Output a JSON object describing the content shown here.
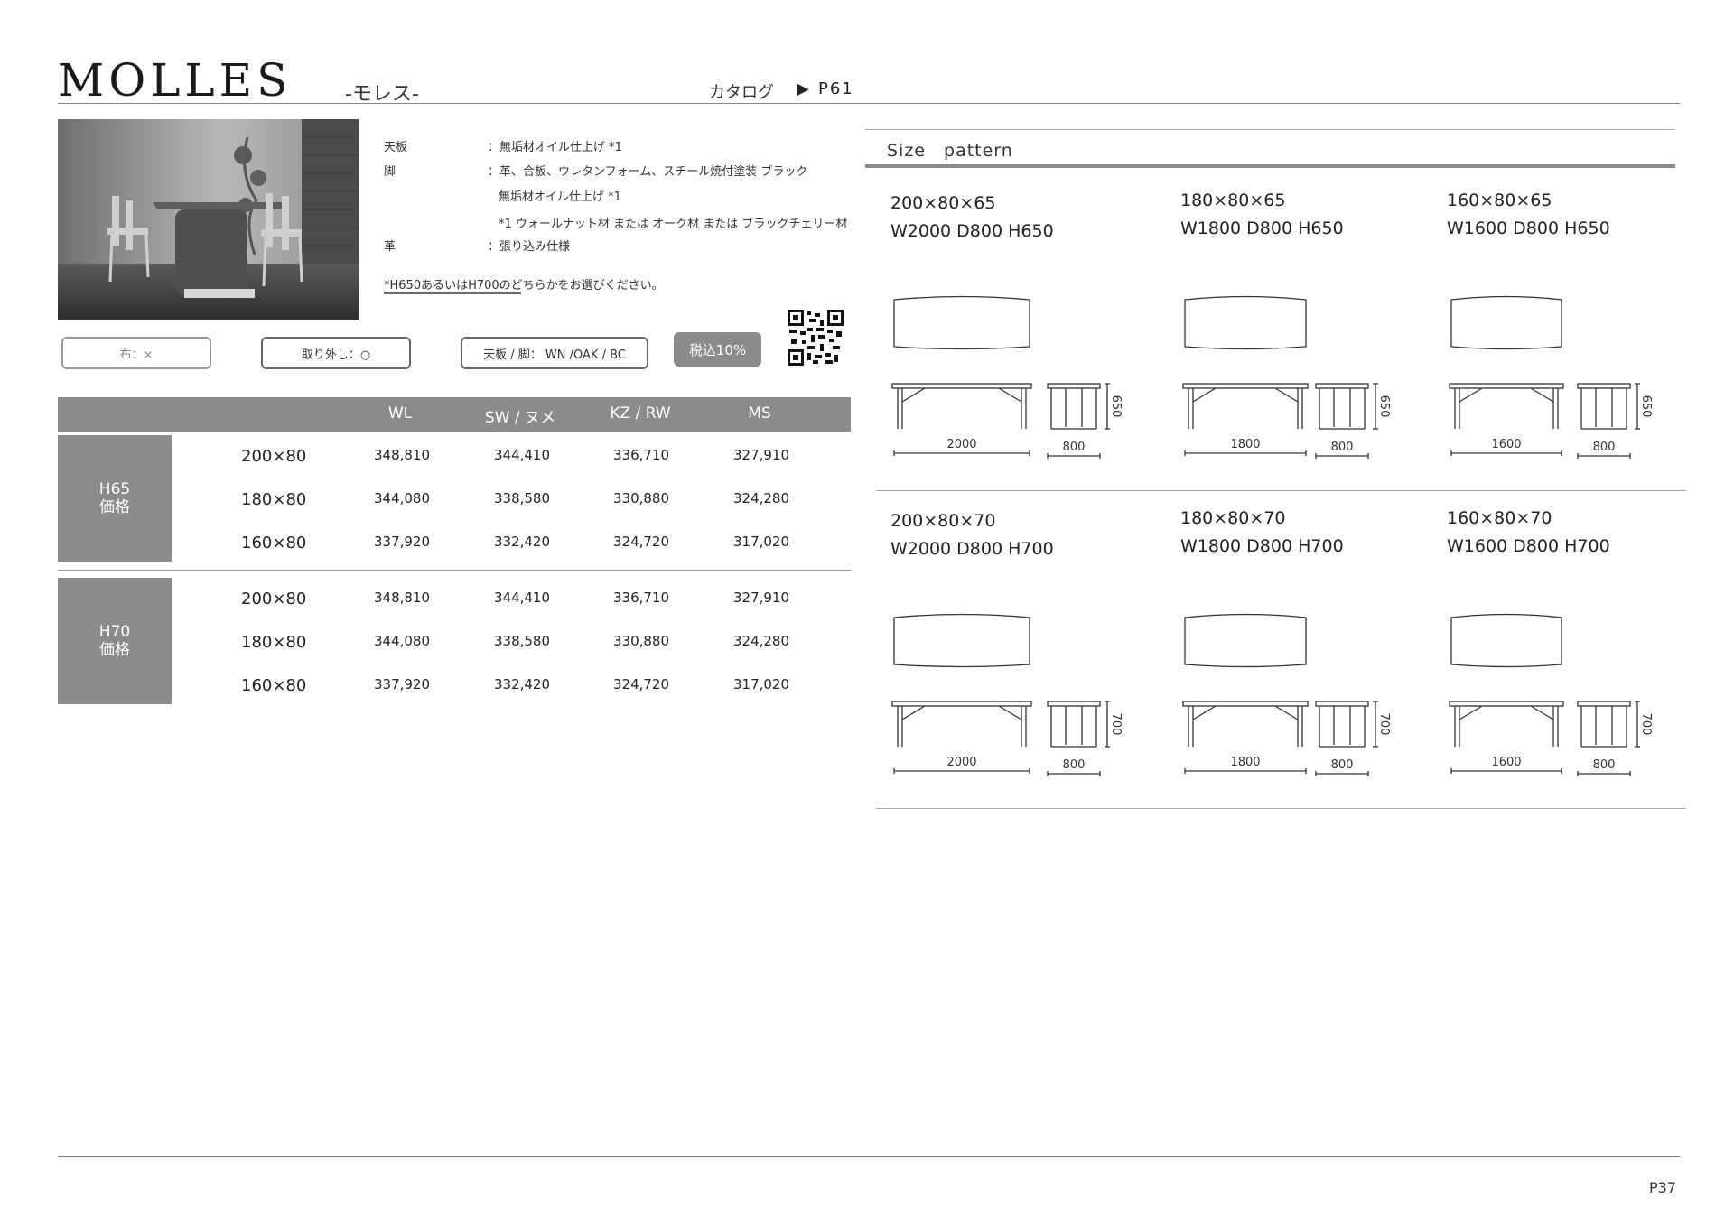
{
  "header": {
    "title": "MOLLES",
    "subtitle": "-モレス-",
    "catalog_label": "カタログ",
    "catalog_arrow": "▶",
    "catalog_page": "P61"
  },
  "specs": {
    "rows": [
      {
        "label": "天板",
        "value": "：無垢材オイル仕上げ *1"
      },
      {
        "label": "脚",
        "value": "：革、合板、ウレタンフォーム、スチール焼付塗装 ブラック"
      },
      {
        "label": "",
        "value": "無垢材オイル仕上げ *1"
      },
      {
        "label": "",
        "value": "*1 ウォールナット材 または オーク材 または ブラックチェリー材"
      },
      {
        "label": "革",
        "value": "：張り込み仕様"
      }
    ],
    "note": "*H650あるいはH700のどちらかをお選びください。"
  },
  "badges": {
    "fabric": "布：×",
    "removable": "取り外し：○",
    "materials": "天板 / 脚： WN /OAK / BC",
    "tax": "税込10%"
  },
  "price_table": {
    "columns": [
      "WL",
      "SW / ヌメ",
      "KZ / RW",
      "MS"
    ],
    "groups": [
      {
        "label_1": "H65",
        "label_2": "価格",
        "rows": [
          {
            "size": "200×80",
            "prices": [
              "348,810",
              "344,410",
              "336,710",
              "327,910"
            ]
          },
          {
            "size": "180×80",
            "prices": [
              "344,080",
              "338,580",
              "330,880",
              "324,280"
            ]
          },
          {
            "size": "160×80",
            "prices": [
              "337,920",
              "332,420",
              "324,720",
              "317,020"
            ]
          }
        ]
      },
      {
        "label_1": "H70",
        "label_2": "価格",
        "rows": [
          {
            "size": "200×80",
            "prices": [
              "348,810",
              "344,410",
              "336,710",
              "327,910"
            ]
          },
          {
            "size": "180×80",
            "prices": [
              "344,080",
              "338,580",
              "330,880",
              "324,280"
            ]
          },
          {
            "size": "160×80",
            "prices": [
              "337,920",
              "332,420",
              "324,720",
              "317,020"
            ]
          }
        ]
      }
    ]
  },
  "size_pattern": {
    "title": "Size　pattern",
    "items": [
      {
        "dim1": "200×80×65",
        "dim2": "W2000 D800 H650",
        "width": "2000",
        "depth": "800",
        "height": "650"
      },
      {
        "dim1": "180×80×65",
        "dim2": "W1800 D800 H650",
        "width": "1800",
        "depth": "800",
        "height": "650"
      },
      {
        "dim1": "160×80×65",
        "dim2": "W1600 D800 H650",
        "width": "1600",
        "depth": "800",
        "height": "650"
      },
      {
        "dim1": "200×80×70",
        "dim2": "W2000 D800 H700",
        "width": "2000",
        "depth": "800",
        "height": "700"
      },
      {
        "dim1": "180×80×70",
        "dim2": "W1800 D800 H700",
        "width": "1800",
        "depth": "800",
        "height": "700"
      },
      {
        "dim1": "160×80×70",
        "dim2": "W1600 D800 H700",
        "width": "1600",
        "depth": "800",
        "height": "700"
      }
    ]
  },
  "footer": {
    "page": "P37"
  }
}
